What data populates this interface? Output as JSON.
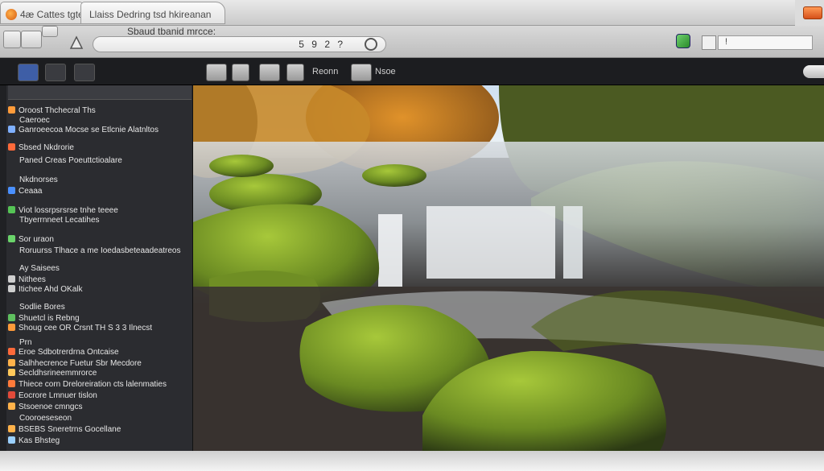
{
  "titlebar": {
    "app_tab": "4æ Cattes tgte",
    "doc_tab": "Llaiss Dedring tsd hkireanan"
  },
  "toolbar": {
    "label": "Sbaud tbanid mrcce:",
    "search_placeholder": "",
    "search_glyphs": "5 9 2 ?",
    "right_field_text": "!"
  },
  "contentbar": {
    "label1": "Reonn",
    "label2": "Nsoe"
  },
  "sidebar": {
    "items": [
      {
        "text": "Oroost Thchecral Ths",
        "color": "#ff9b3a"
      },
      {
        "text": "Caeroec",
        "color": ""
      },
      {
        "text": "Ganroeecoa Mocse se Etlcnie Alatnltos",
        "color": "#7fb0ff"
      },
      {
        "text": "Sbsed Nkdrorie",
        "color": "#ff6a3a"
      },
      {
        "text": "Paned Creas Poeuttctioalare",
        "color": ""
      },
      {
        "text": "Nkdnorses",
        "color": ""
      },
      {
        "text": "Ceaaa",
        "color": "#4a90ff"
      },
      {
        "text": "Viot lossrpsrsrse tnhe teeee",
        "color": "#55c455"
      },
      {
        "text": "Tbyerrnneet Lecatihes",
        "color": ""
      },
      {
        "text": "Sor uraon",
        "color": "#6ad46a"
      },
      {
        "text": "Roruurss Tlhace a me Ioedasbeteaadeatreos",
        "color": ""
      },
      {
        "text": "Ay Saisees",
        "color": ""
      },
      {
        "text": "Nithees",
        "color": "#cfcfcf"
      },
      {
        "text": "Itichee Ahd OKalk",
        "color": "#cfcfcf"
      },
      {
        "text": "Sodlie Bores",
        "color": ""
      },
      {
        "text": "Shuetcl is Rebng",
        "color": "#5fc05f"
      },
      {
        "text": "Shoug cee OR Crsnt   TH S 3 3 Ilnecst",
        "color": "#ff9b3a"
      },
      {
        "text": "Prn",
        "color": ""
      },
      {
        "text": "Eroe Sdbotrerdrna Ontcaise",
        "color": "#ff6a3a"
      },
      {
        "text": "Salhhecrence Fuetur Sbr Mecdore",
        "color": "#ffb24a"
      },
      {
        "text": "Secldhsrineemmrorce",
        "color": "#ffc85a"
      },
      {
        "text": "Thiece corn Dreloreiration cts lalenmaties",
        "color": "#ff7a3a"
      },
      {
        "text": "Eocrore Lmnuer tislon",
        "color": "#e24a3a"
      },
      {
        "text": "Stsoenoe cmngcs",
        "color": "#ffb24a"
      },
      {
        "text": "Cooroeseseon",
        "color": ""
      },
      {
        "text": "BSEBS Sneretrns Gocellane",
        "color": "#ffb24a"
      },
      {
        "text": "Kas Bhsteg",
        "color": "#9ad0ff"
      }
    ]
  }
}
